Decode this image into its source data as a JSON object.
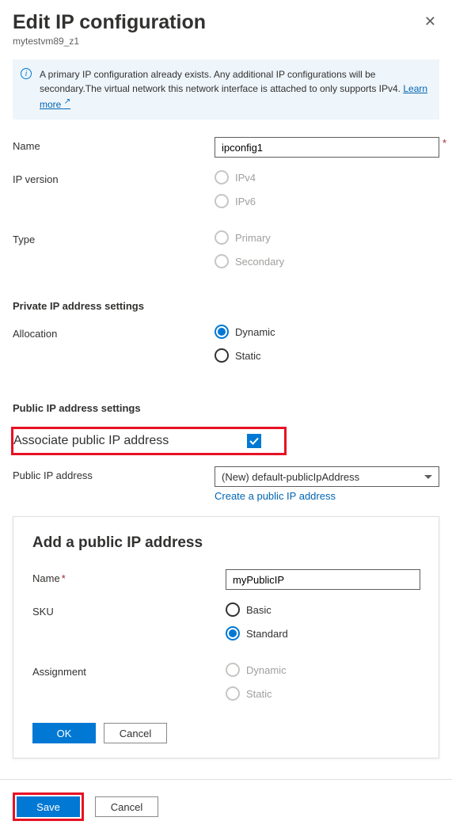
{
  "header": {
    "title": "Edit IP configuration",
    "subtitle": "mytestvm89_z1"
  },
  "info": {
    "text": "A primary IP configuration already exists. Any additional IP configurations will be secondary.The virtual network this network interface is attached to only supports IPv4.  ",
    "link_text": "Learn more"
  },
  "fields": {
    "name_label": "Name",
    "name_value": "ipconfig1",
    "ip_version_label": "IP version",
    "ip_version_options": {
      "v4": "IPv4",
      "v6": "IPv6"
    },
    "type_label": "Type",
    "type_options": {
      "primary": "Primary",
      "secondary": "Secondary"
    }
  },
  "private": {
    "heading": "Private IP address settings",
    "allocation_label": "Allocation",
    "allocation_options": {
      "dynamic": "Dynamic",
      "static": "Static"
    }
  },
  "public": {
    "heading": "Public IP address settings",
    "associate_label": "Associate public IP address",
    "associate_checked": true,
    "address_label": "Public IP address",
    "address_value": "(New) default-publicIpAddress",
    "create_link": "Create a public IP address"
  },
  "add_panel": {
    "title": "Add a public IP address",
    "name_label": "Name",
    "name_value": "myPublicIP",
    "sku_label": "SKU",
    "sku_options": {
      "basic": "Basic",
      "standard": "Standard"
    },
    "assignment_label": "Assignment",
    "assignment_options": {
      "dynamic": "Dynamic",
      "static": "Static"
    },
    "ok": "OK",
    "cancel": "Cancel"
  },
  "footer": {
    "save": "Save",
    "cancel": "Cancel"
  }
}
